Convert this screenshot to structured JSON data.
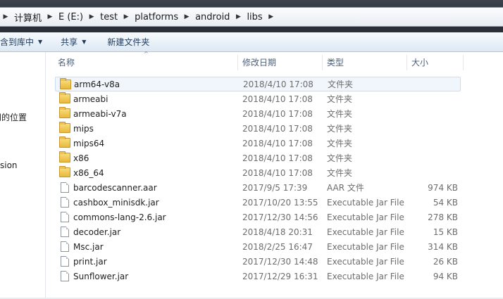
{
  "breadcrumb": [
    {
      "label": "计算机"
    },
    {
      "label": "E (E:)"
    },
    {
      "label": "test"
    },
    {
      "label": "platforms"
    },
    {
      "label": "android"
    },
    {
      "label": "libs"
    }
  ],
  "toolbar": {
    "include_library": "包含到库中",
    "share": "共享",
    "new_folder": "新建文件夹"
  },
  "sidebar": {
    "recent_places": "问的位置",
    "item_sion": "sion"
  },
  "columns": {
    "name": "名称",
    "date": "修改日期",
    "type": "类型",
    "size": "大小"
  },
  "files": [
    {
      "name": "arm64-v8a",
      "date": "2018/4/10 17:08",
      "type": "文件夹",
      "size": "",
      "kind": "folder-icon",
      "selected": true
    },
    {
      "name": "armeabi",
      "date": "2018/4/10 17:08",
      "type": "文件夹",
      "size": "",
      "kind": "folder-icon"
    },
    {
      "name": "armeabi-v7a",
      "date": "2018/4/10 17:08",
      "type": "文件夹",
      "size": "",
      "kind": "folder-icon"
    },
    {
      "name": "mips",
      "date": "2018/4/10 17:08",
      "type": "文件夹",
      "size": "",
      "kind": "folder-icon"
    },
    {
      "name": "mips64",
      "date": "2018/4/10 17:08",
      "type": "文件夹",
      "size": "",
      "kind": "folder-icon"
    },
    {
      "name": "x86",
      "date": "2018/4/10 17:08",
      "type": "文件夹",
      "size": "",
      "kind": "folder-icon"
    },
    {
      "name": "x86_64",
      "date": "2018/4/10 17:08",
      "type": "文件夹",
      "size": "",
      "kind": "folder-icon"
    },
    {
      "name": "barcodescanner.aar",
      "date": "2017/9/5 17:39",
      "type": "AAR 文件",
      "size": "974 KB",
      "kind": "file-icon"
    },
    {
      "name": "cashbox_minisdk.jar",
      "date": "2017/10/20 13:55",
      "type": "Executable Jar File",
      "size": "54 KB",
      "kind": "jar-file-icon"
    },
    {
      "name": "commons-lang-2.6.jar",
      "date": "2017/12/30 14:56",
      "type": "Executable Jar File",
      "size": "278 KB",
      "kind": "jar-file-icon"
    },
    {
      "name": "decoder.jar",
      "date": "2018/4/18 20:31",
      "type": "Executable Jar File",
      "size": "15 KB",
      "kind": "jar-file-icon"
    },
    {
      "name": "Msc.jar",
      "date": "2018/2/25 16:47",
      "type": "Executable Jar File",
      "size": "314 KB",
      "kind": "jar-file-icon"
    },
    {
      "name": "print.jar",
      "date": "2017/12/30 14:48",
      "type": "Executable Jar File",
      "size": "26 KB",
      "kind": "jar-file-icon"
    },
    {
      "name": "Sunflower.jar",
      "date": "2017/12/29 16:31",
      "type": "Executable Jar File",
      "size": "94 KB",
      "kind": "jar-file-icon"
    }
  ]
}
